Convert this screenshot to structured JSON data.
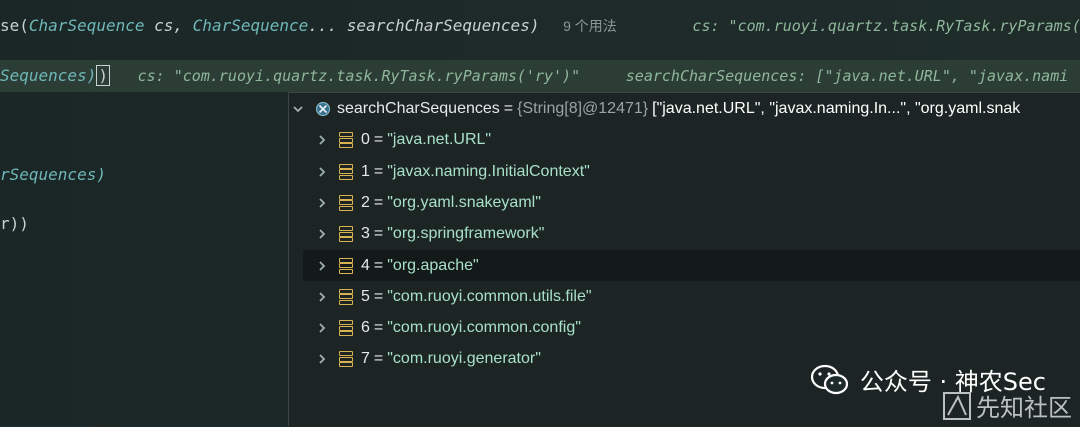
{
  "editor": {
    "line1": {
      "prefix": "se(",
      "type1": "CharSequence",
      "param1": " cs, ",
      "type2": "CharSequence",
      "param2": "... searchCharSequences)",
      "usages": "9 个用法",
      "inline": "cs: \"com.ruoyi.quartz.task.RyTask.ryParams('"
    },
    "line2": {
      "code": "Sequences)",
      "cursor": ")",
      "inline1": "cs: \"com.ruoyi.quartz.task.RyTask.ryParams('ry')\"",
      "inline2": "searchCharSequences: [\"java.net.URL\", \"javax.nami"
    },
    "line3": "rSequences)",
    "line4": "r))"
  },
  "debugger": {
    "root": {
      "name": "searchCharSequences",
      "meta": "{String[8]@12471}",
      "preview": "[\"java.net.URL\", \"javax.naming.In...\", \"org.yaml.snak"
    },
    "items": [
      {
        "index": "0",
        "value": "\"java.net.URL\""
      },
      {
        "index": "1",
        "value": "\"javax.naming.InitialContext\""
      },
      {
        "index": "2",
        "value": "\"org.yaml.snakeyaml\""
      },
      {
        "index": "3",
        "value": "\"org.springframework\""
      },
      {
        "index": "4",
        "value": "\"org.apache\""
      },
      {
        "index": "5",
        "value": "\"com.ruoyi.common.utils.file\""
      },
      {
        "index": "6",
        "value": "\"com.ruoyi.common.config\""
      },
      {
        "index": "7",
        "value": "\"com.ruoyi.generator\""
      }
    ],
    "selected_index": 4
  },
  "watermark": {
    "primary": "公众号 · 神农Sec",
    "secondary": "先知社区",
    "icon": "wechat-icon"
  },
  "colors": {
    "accent_value": "#a8e0c7",
    "array_icon": "#d9b352",
    "selected_row": "#141a1a"
  }
}
